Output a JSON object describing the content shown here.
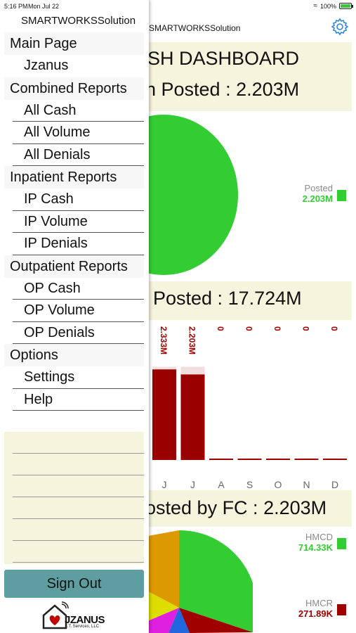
{
  "status_bar": {
    "time": "5:16 PM",
    "date": "Mon Jul 22",
    "battery": "100%"
  },
  "app": {
    "name": "SMARTWORKSSolution"
  },
  "drawer": {
    "title": "SMARTWORKSSolution",
    "sections": [
      {
        "label": "Main Page",
        "items": [
          "Jzanus"
        ]
      },
      {
        "label": "Combined Reports",
        "items": [
          "All Cash",
          "All Volume",
          "All Denials"
        ]
      },
      {
        "label": "Inpatient Reports",
        "items": [
          "IP Cash",
          "IP Volume",
          "IP Denials"
        ]
      },
      {
        "label": "Outpatient Reports",
        "items": [
          "OP Cash",
          "OP Volume",
          "OP Denials"
        ]
      },
      {
        "label": "Options",
        "items": [
          "Settings",
          "Help"
        ]
      }
    ],
    "sign_out": "Sign Out",
    "logo": {
      "name": "JZANUS",
      "sub": "I.T. Services, LLC"
    }
  },
  "dashboard": {
    "heading": "SH DASHBOARD",
    "cash_posted": "h Posted : 2.203M",
    "pie1_legend": {
      "label": "Posted",
      "value": "2.203M"
    },
    "ytd_posted": "Posted : 17.724M",
    "fc_posted": "osted by FC : 2.203M",
    "fc_legend": [
      {
        "label": "HMCD",
        "value": "714.33K",
        "color": "#33cc33"
      },
      {
        "label": "HMCR",
        "value": "271.89K",
        "color": "#a00000"
      }
    ]
  },
  "colors": {
    "green": "#33cc33",
    "dark_red": "#9b0000",
    "pink": "#f3dede",
    "band": "#f5f4dc",
    "teal": "#5e9ea0"
  },
  "chart_data": [
    {
      "type": "pie",
      "title": "h Posted : 2.203M",
      "slices": [
        {
          "label": "Posted",
          "value": 2.203,
          "color": "#33cc33"
        }
      ]
    },
    {
      "type": "bar",
      "title": "Posted : 17.724M",
      "categories": [
        "J",
        "J",
        "A",
        "S",
        "O",
        "N",
        "D"
      ],
      "values": [
        2.333,
        2.203,
        0,
        0,
        0,
        0,
        0
      ],
      "data_labels": [
        "2.333M",
        "2.203M",
        "0",
        "0",
        "0",
        "0",
        "0"
      ]
    },
    {
      "type": "pie",
      "title": "osted by FC : 2.203M",
      "slices": [
        {
          "label": "HMCD",
          "value": 714.33,
          "color": "#33cc33"
        },
        {
          "label": "HMCR",
          "value": 271.89,
          "color": "#a00000"
        }
      ]
    }
  ]
}
